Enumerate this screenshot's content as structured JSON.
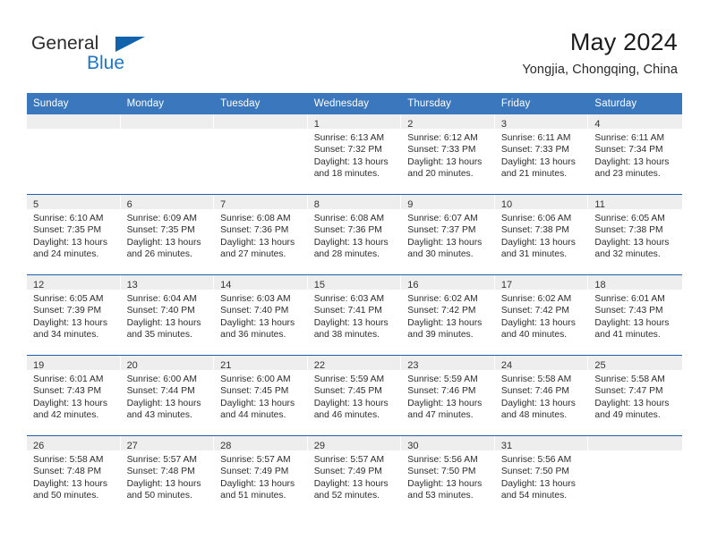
{
  "logo": {
    "line1": "General",
    "line2": "Blue",
    "triangle_color": "#1163ad",
    "blue_text_color": "#1f77c4"
  },
  "header": {
    "month_title": "May 2024",
    "location": "Yongjia, Chongqing, China"
  },
  "theme": {
    "header_bar_color": "#3b77bd",
    "row_divider_color": "#1f5fa6",
    "cell_head_color": "#eeeeee"
  },
  "weekdays": [
    "Sunday",
    "Monday",
    "Tuesday",
    "Wednesday",
    "Thursday",
    "Friday",
    "Saturday"
  ],
  "weeks": [
    [
      {
        "day": "",
        "sunrise": "",
        "sunset": "",
        "daylight1": "",
        "daylight2": ""
      },
      {
        "day": "",
        "sunrise": "",
        "sunset": "",
        "daylight1": "",
        "daylight2": ""
      },
      {
        "day": "",
        "sunrise": "",
        "sunset": "",
        "daylight1": "",
        "daylight2": ""
      },
      {
        "day": "1",
        "sunrise": "Sunrise: 6:13 AM",
        "sunset": "Sunset: 7:32 PM",
        "daylight1": "Daylight: 13 hours",
        "daylight2": "and 18 minutes."
      },
      {
        "day": "2",
        "sunrise": "Sunrise: 6:12 AM",
        "sunset": "Sunset: 7:33 PM",
        "daylight1": "Daylight: 13 hours",
        "daylight2": "and 20 minutes."
      },
      {
        "day": "3",
        "sunrise": "Sunrise: 6:11 AM",
        "sunset": "Sunset: 7:33 PM",
        "daylight1": "Daylight: 13 hours",
        "daylight2": "and 21 minutes."
      },
      {
        "day": "4",
        "sunrise": "Sunrise: 6:11 AM",
        "sunset": "Sunset: 7:34 PM",
        "daylight1": "Daylight: 13 hours",
        "daylight2": "and 23 minutes."
      }
    ],
    [
      {
        "day": "5",
        "sunrise": "Sunrise: 6:10 AM",
        "sunset": "Sunset: 7:35 PM",
        "daylight1": "Daylight: 13 hours",
        "daylight2": "and 24 minutes."
      },
      {
        "day": "6",
        "sunrise": "Sunrise: 6:09 AM",
        "sunset": "Sunset: 7:35 PM",
        "daylight1": "Daylight: 13 hours",
        "daylight2": "and 26 minutes."
      },
      {
        "day": "7",
        "sunrise": "Sunrise: 6:08 AM",
        "sunset": "Sunset: 7:36 PM",
        "daylight1": "Daylight: 13 hours",
        "daylight2": "and 27 minutes."
      },
      {
        "day": "8",
        "sunrise": "Sunrise: 6:08 AM",
        "sunset": "Sunset: 7:36 PM",
        "daylight1": "Daylight: 13 hours",
        "daylight2": "and 28 minutes."
      },
      {
        "day": "9",
        "sunrise": "Sunrise: 6:07 AM",
        "sunset": "Sunset: 7:37 PM",
        "daylight1": "Daylight: 13 hours",
        "daylight2": "and 30 minutes."
      },
      {
        "day": "10",
        "sunrise": "Sunrise: 6:06 AM",
        "sunset": "Sunset: 7:38 PM",
        "daylight1": "Daylight: 13 hours",
        "daylight2": "and 31 minutes."
      },
      {
        "day": "11",
        "sunrise": "Sunrise: 6:05 AM",
        "sunset": "Sunset: 7:38 PM",
        "daylight1": "Daylight: 13 hours",
        "daylight2": "and 32 minutes."
      }
    ],
    [
      {
        "day": "12",
        "sunrise": "Sunrise: 6:05 AM",
        "sunset": "Sunset: 7:39 PM",
        "daylight1": "Daylight: 13 hours",
        "daylight2": "and 34 minutes."
      },
      {
        "day": "13",
        "sunrise": "Sunrise: 6:04 AM",
        "sunset": "Sunset: 7:40 PM",
        "daylight1": "Daylight: 13 hours",
        "daylight2": "and 35 minutes."
      },
      {
        "day": "14",
        "sunrise": "Sunrise: 6:03 AM",
        "sunset": "Sunset: 7:40 PM",
        "daylight1": "Daylight: 13 hours",
        "daylight2": "and 36 minutes."
      },
      {
        "day": "15",
        "sunrise": "Sunrise: 6:03 AM",
        "sunset": "Sunset: 7:41 PM",
        "daylight1": "Daylight: 13 hours",
        "daylight2": "and 38 minutes."
      },
      {
        "day": "16",
        "sunrise": "Sunrise: 6:02 AM",
        "sunset": "Sunset: 7:42 PM",
        "daylight1": "Daylight: 13 hours",
        "daylight2": "and 39 minutes."
      },
      {
        "day": "17",
        "sunrise": "Sunrise: 6:02 AM",
        "sunset": "Sunset: 7:42 PM",
        "daylight1": "Daylight: 13 hours",
        "daylight2": "and 40 minutes."
      },
      {
        "day": "18",
        "sunrise": "Sunrise: 6:01 AM",
        "sunset": "Sunset: 7:43 PM",
        "daylight1": "Daylight: 13 hours",
        "daylight2": "and 41 minutes."
      }
    ],
    [
      {
        "day": "19",
        "sunrise": "Sunrise: 6:01 AM",
        "sunset": "Sunset: 7:43 PM",
        "daylight1": "Daylight: 13 hours",
        "daylight2": "and 42 minutes."
      },
      {
        "day": "20",
        "sunrise": "Sunrise: 6:00 AM",
        "sunset": "Sunset: 7:44 PM",
        "daylight1": "Daylight: 13 hours",
        "daylight2": "and 43 minutes."
      },
      {
        "day": "21",
        "sunrise": "Sunrise: 6:00 AM",
        "sunset": "Sunset: 7:45 PM",
        "daylight1": "Daylight: 13 hours",
        "daylight2": "and 44 minutes."
      },
      {
        "day": "22",
        "sunrise": "Sunrise: 5:59 AM",
        "sunset": "Sunset: 7:45 PM",
        "daylight1": "Daylight: 13 hours",
        "daylight2": "and 46 minutes."
      },
      {
        "day": "23",
        "sunrise": "Sunrise: 5:59 AM",
        "sunset": "Sunset: 7:46 PM",
        "daylight1": "Daylight: 13 hours",
        "daylight2": "and 47 minutes."
      },
      {
        "day": "24",
        "sunrise": "Sunrise: 5:58 AM",
        "sunset": "Sunset: 7:46 PM",
        "daylight1": "Daylight: 13 hours",
        "daylight2": "and 48 minutes."
      },
      {
        "day": "25",
        "sunrise": "Sunrise: 5:58 AM",
        "sunset": "Sunset: 7:47 PM",
        "daylight1": "Daylight: 13 hours",
        "daylight2": "and 49 minutes."
      }
    ],
    [
      {
        "day": "26",
        "sunrise": "Sunrise: 5:58 AM",
        "sunset": "Sunset: 7:48 PM",
        "daylight1": "Daylight: 13 hours",
        "daylight2": "and 50 minutes."
      },
      {
        "day": "27",
        "sunrise": "Sunrise: 5:57 AM",
        "sunset": "Sunset: 7:48 PM",
        "daylight1": "Daylight: 13 hours",
        "daylight2": "and 50 minutes."
      },
      {
        "day": "28",
        "sunrise": "Sunrise: 5:57 AM",
        "sunset": "Sunset: 7:49 PM",
        "daylight1": "Daylight: 13 hours",
        "daylight2": "and 51 minutes."
      },
      {
        "day": "29",
        "sunrise": "Sunrise: 5:57 AM",
        "sunset": "Sunset: 7:49 PM",
        "daylight1": "Daylight: 13 hours",
        "daylight2": "and 52 minutes."
      },
      {
        "day": "30",
        "sunrise": "Sunrise: 5:56 AM",
        "sunset": "Sunset: 7:50 PM",
        "daylight1": "Daylight: 13 hours",
        "daylight2": "and 53 minutes."
      },
      {
        "day": "31",
        "sunrise": "Sunrise: 5:56 AM",
        "sunset": "Sunset: 7:50 PM",
        "daylight1": "Daylight: 13 hours",
        "daylight2": "and 54 minutes."
      },
      {
        "day": "",
        "sunrise": "",
        "sunset": "",
        "daylight1": "",
        "daylight2": ""
      }
    ]
  ]
}
